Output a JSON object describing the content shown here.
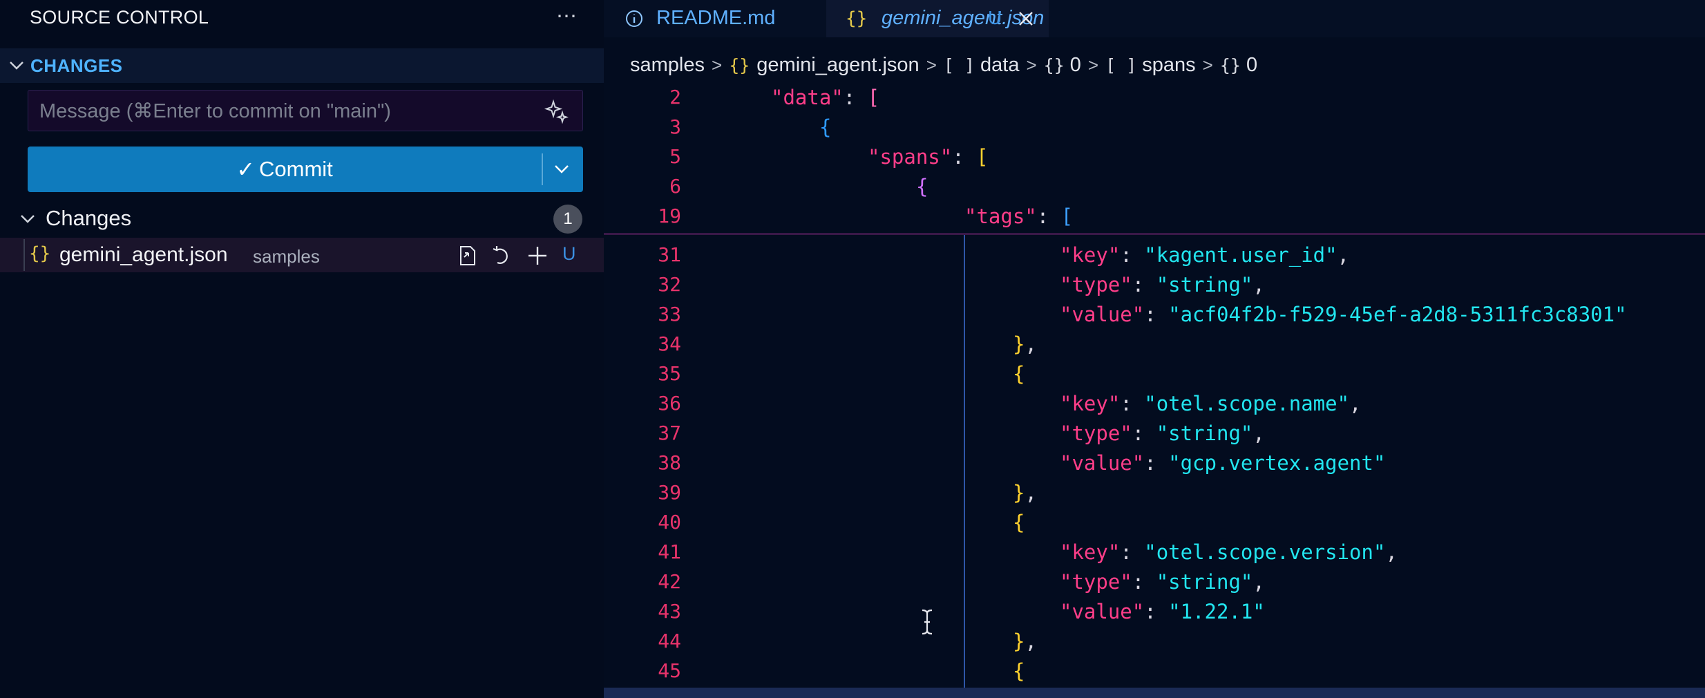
{
  "sidebar": {
    "title": "SOURCE CONTROL",
    "more_icon": "ellipsis-icon",
    "section_label": "CHANGES",
    "message_placeholder": "Message (⌘Enter to commit on \"main\")",
    "message_value": "",
    "commit_label": "Commit",
    "changes_group_label": "Changes",
    "changes_count": "1",
    "file": {
      "name": "gemini_agent.json",
      "dir": "samples",
      "status": "U"
    }
  },
  "tabs": [
    {
      "label": "README.md",
      "icon": "info-icon"
    },
    {
      "label": "gemini_agent.json",
      "icon": "json-icon",
      "status": "U",
      "active": true
    }
  ],
  "breadcrumb": {
    "folder": "samples",
    "file": "gemini_agent.json",
    "seg_data": "data",
    "seg_0a": "0",
    "seg_spans": "spans",
    "seg_0b": "0"
  },
  "code": {
    "sticky": [
      {
        "n": "2",
        "key": "\"data\""
      },
      {
        "n": "3"
      },
      {
        "n": "5",
        "key": "\"spans\""
      },
      {
        "n": "6"
      },
      {
        "n": "19",
        "key": "\"tags\""
      }
    ],
    "lines": [
      {
        "n": "31",
        "key": "\"key\"",
        "val": "\"kagent.user_id\""
      },
      {
        "n": "32",
        "key": "\"type\"",
        "val": "\"string\""
      },
      {
        "n": "33",
        "key": "\"value\"",
        "val": "\"acf04f2b-f529-45ef-a2d8-5311fc3c8301\""
      },
      {
        "n": "34"
      },
      {
        "n": "35"
      },
      {
        "n": "36",
        "key": "\"key\"",
        "val": "\"otel.scope.name\""
      },
      {
        "n": "37",
        "key": "\"type\"",
        "val": "\"string\""
      },
      {
        "n": "38",
        "key": "\"value\"",
        "val": "\"gcp.vertex.agent\""
      },
      {
        "n": "39"
      },
      {
        "n": "40"
      },
      {
        "n": "41",
        "key": "\"key\"",
        "val": "\"otel.scope.version\""
      },
      {
        "n": "42",
        "key": "\"type\"",
        "val": "\"string\""
      },
      {
        "n": "43",
        "key": "\"value\"",
        "val": "\"1.22.1\""
      },
      {
        "n": "44"
      },
      {
        "n": "45"
      }
    ]
  },
  "colors": {
    "accent": "#0f7bbd",
    "link": "#5fb0ff",
    "line_numbers": "#e8336b",
    "json_key": "#ff3e89",
    "json_string": "#22e6f0"
  }
}
